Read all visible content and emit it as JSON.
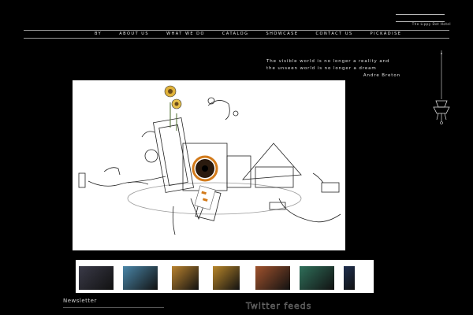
{
  "header": {
    "tagline": "The Lippy Dot Hotel"
  },
  "nav": {
    "items": [
      "BY",
      "ABOUT US",
      "WHAT WE DO",
      "CATALOG",
      "SHOWCASE",
      "CONTACT US",
      "PICKADISE"
    ]
  },
  "quote": {
    "line1": "The visible world is no longer a reality and",
    "line2": "the unseen world is no longer a dream",
    "author": "Andre Breton"
  },
  "hero": {
    "image": "sketch-illustration"
  },
  "gallery": {
    "thumbnails": [
      {
        "name": "thumb-cube",
        "color": "#3a3a48"
      },
      {
        "name": "thumb-colorful-room",
        "color": "#4a86a8"
      },
      {
        "name": "thumb-gate",
        "color": "#b9822e"
      },
      {
        "name": "thumb-statue",
        "color": "#b8862a"
      },
      {
        "name": "thumb-arches",
        "color": "#a0522d"
      },
      {
        "name": "thumb-green-interior",
        "color": "#2f6f5a"
      },
      {
        "name": "thumb-partial",
        "color": "#1f2f4f"
      }
    ]
  },
  "footer": {
    "newsletter_label": "Newsletter",
    "twitter_label": "Twitter feeds"
  }
}
